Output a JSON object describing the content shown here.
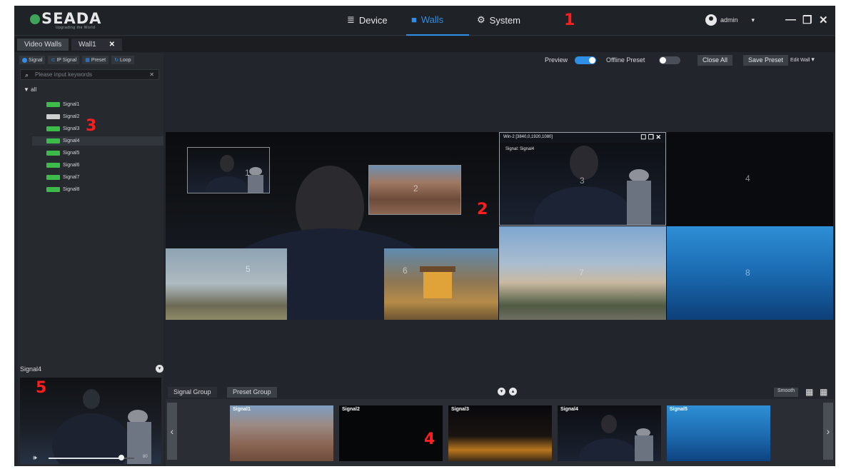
{
  "app": {
    "logo_text": "SEADA",
    "logo_tagline": "Upgrading the World"
  },
  "nav": {
    "device": "Device",
    "walls": "Walls",
    "system": "System",
    "active": "Walls"
  },
  "user": {
    "name": "admin"
  },
  "annotations": {
    "n1": "1",
    "n2": "2",
    "n3": "3",
    "n4": "4",
    "n5": "5"
  },
  "tabs": {
    "video_walls": "Video Walls",
    "wall1": "Wall1"
  },
  "signal_tabs": [
    "Signal",
    "IP Signal",
    "Preset",
    "Loop"
  ],
  "search": {
    "placeholder": "Please input keywords"
  },
  "tree": {
    "root": "all",
    "signals": [
      {
        "label": "Signal1",
        "status": "green"
      },
      {
        "label": "Signal2",
        "status": "gray"
      },
      {
        "label": "Signal3",
        "status": "green"
      },
      {
        "label": "Signal4",
        "status": "green",
        "selected": true
      },
      {
        "label": "Signal5",
        "status": "green"
      },
      {
        "label": "Signal6",
        "status": "green"
      },
      {
        "label": "Signal7",
        "status": "green"
      },
      {
        "label": "Signal8",
        "status": "green"
      }
    ]
  },
  "preview_panel": {
    "signal": "Signal4",
    "volume": 0.85,
    "volume_label": "80"
  },
  "toolbar": {
    "preview": "Preview",
    "preview_on": true,
    "offline_preset": "Offline Preset",
    "offline_preset_on": false,
    "close_all": "Close All",
    "save_preset": "Save Preset",
    "edit_wall": "Edit Wall"
  },
  "wall": {
    "windows": [
      {
        "num": "1"
      },
      {
        "num": "2"
      },
      {
        "num": "3"
      },
      {
        "num": "4"
      },
      {
        "num": "5"
      },
      {
        "num": "6"
      },
      {
        "num": "7"
      },
      {
        "num": "8"
      }
    ],
    "selected_window": {
      "title": "Win-2 [3840,0,1920,1080]",
      "signal": "Signal: Signal4"
    }
  },
  "groups": {
    "signal_group": "Signal Group",
    "preset_group": "Preset Group",
    "smooth": "Smooth"
  },
  "thumbnails": [
    "Signal1",
    "Signal2",
    "Signal3",
    "Signal4",
    "Signal5"
  ],
  "colors": {
    "accent": "#2f8ee5",
    "signal_ok": "#3dbb4a",
    "annotation": "#ff1d1d"
  }
}
